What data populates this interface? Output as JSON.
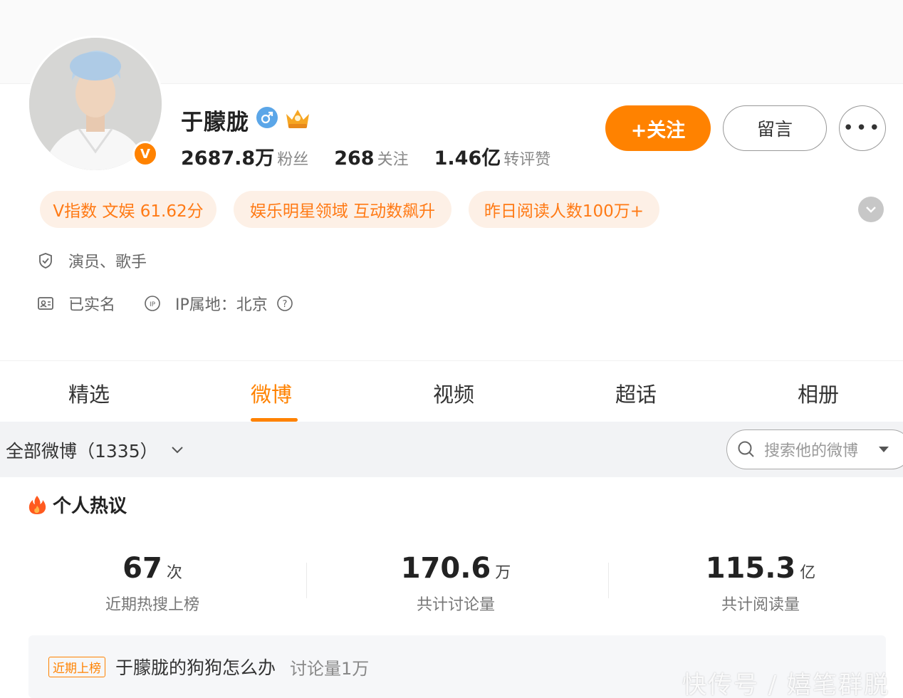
{
  "profile": {
    "name": "于朦胧",
    "avatar_badge": "V",
    "stats": [
      {
        "value": "2687.8万",
        "label": "粉丝"
      },
      {
        "value": "268",
        "label": "关注"
      },
      {
        "value": "1.46亿",
        "label": "转评赞"
      }
    ]
  },
  "actions": {
    "follow_label": "+关注",
    "message_label": "留言",
    "more_label": "•••"
  },
  "tags": [
    "V指数 文娱 61.62分",
    "娱乐明星领域 互动数飙升",
    "昨日阅读人数100万+"
  ],
  "info": {
    "occupation": "演员、歌手",
    "real_name": "已实名",
    "ip_location": "IP属地：北京"
  },
  "tabs": [
    "精选",
    "微博",
    "视频",
    "超话",
    "相册"
  ],
  "active_tab": "微博",
  "filter": {
    "label": "全部微博（1335）",
    "search_placeholder": "搜索他的微博"
  },
  "hot_section": {
    "title": "个人热议",
    "metrics": [
      {
        "value": "67",
        "unit": "次",
        "label": "近期热搜上榜"
      },
      {
        "value": "170.6",
        "unit": "万",
        "label": "共计讨论量"
      },
      {
        "value": "115.3",
        "unit": "亿",
        "label": "共计阅读量"
      }
    ],
    "item": {
      "badge": "近期上榜",
      "text": "于朦胧的狗狗怎么办",
      "discussion": "讨论量1万"
    }
  },
  "watermark": "快传号 / 嬉笔群脱",
  "colors": {
    "accent": "#ff8200",
    "tag_bg": "#fdf0e6",
    "verify_blue": "#5ba6e8"
  }
}
